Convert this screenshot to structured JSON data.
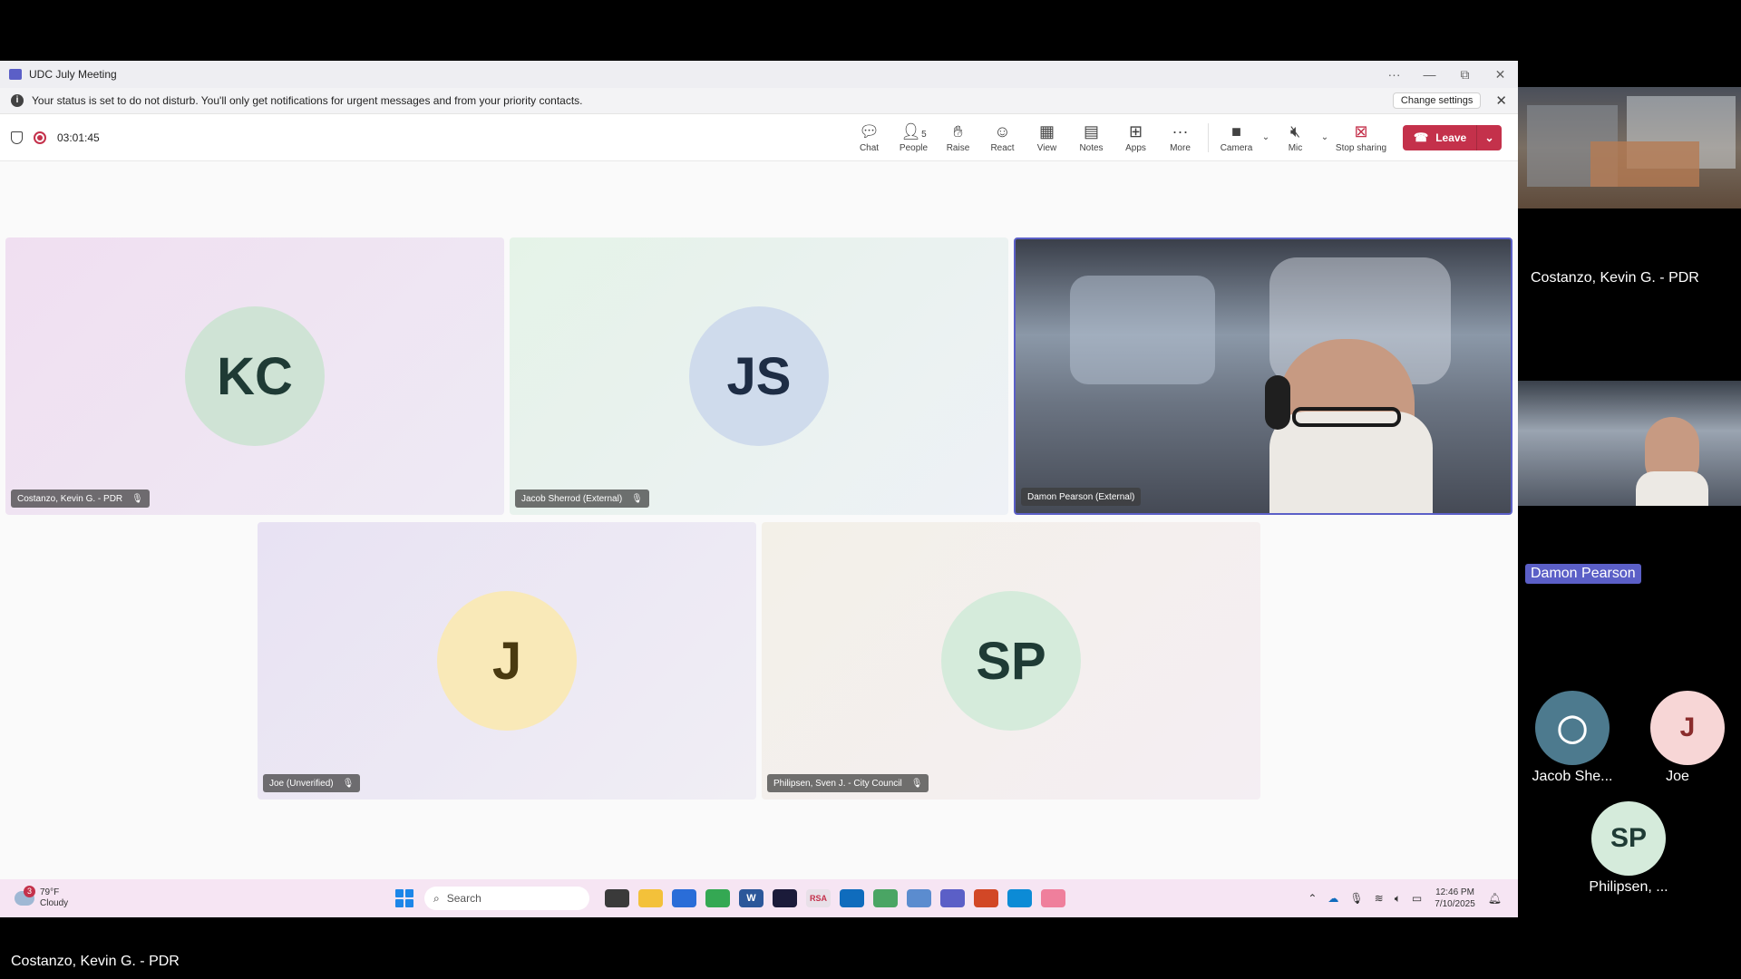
{
  "window": {
    "title": "UDC July Meeting",
    "controls": [
      "···",
      "—",
      "⧉",
      "✕"
    ]
  },
  "notice": {
    "text": "Your status is set to do not disturb. You'll only get notifications for urgent messages and from your priority contacts.",
    "button": "Change settings"
  },
  "toolbar": {
    "timer": "03:01:45",
    "buttons": [
      {
        "label": "Chat",
        "icon": "chat-icon"
      },
      {
        "label": "People",
        "icon": "people-icon",
        "count": "5"
      },
      {
        "label": "Raise",
        "icon": "hand-icon"
      },
      {
        "label": "React",
        "icon": "smile-icon"
      },
      {
        "label": "View",
        "icon": "grid-icon"
      },
      {
        "label": "Notes",
        "icon": "notes-icon"
      },
      {
        "label": "Apps",
        "icon": "plus-icon"
      },
      {
        "label": "More",
        "icon": "more-icon"
      }
    ],
    "camera": "Camera",
    "mic": "Mic",
    "stop_sharing": "Stop sharing",
    "leave": "Leave"
  },
  "participants": [
    {
      "initials": "KC",
      "name": "Costanzo, Kevin G. - PDR",
      "avatar_color": "#cfe3d5",
      "bg": "#f1e3f2"
    },
    {
      "initials": "JS",
      "name": "Jacob Sherrod (External)",
      "avatar_color": "#cfdbec",
      "bg": "#e8f3ea"
    },
    {
      "initials": "",
      "name": "Damon Pearson (External)",
      "video": true,
      "active_speaker": true
    },
    {
      "initials": "J",
      "name": "Joe (Unverified)",
      "avatar_color": "#f9e9b8",
      "bg": "#ece6f4"
    },
    {
      "initials": "SP",
      "name": "Philipsen, Sven J. - City Council",
      "avatar_color": "#d5ebdb",
      "bg": "#f3eef2"
    }
  ],
  "taskbar": {
    "weather_temp": "79°F",
    "weather_desc": "Cloudy",
    "weather_badge": "3",
    "search_placeholder": "Search",
    "time": "12:46 PM",
    "date": "7/10/2025"
  },
  "side_panel": {
    "name1": "Costanzo, Kevin G. - PDR",
    "name2": "Damon Pearson",
    "p1_name": "Jacob She...",
    "p2_name": "Joe",
    "p2_initial": "J",
    "p3_name": "Philipsen, ...",
    "p3_initials": "SP"
  },
  "bottom_caption": "Costanzo, Kevin G. - PDR",
  "colors": {
    "brand": "#5b5fc7",
    "leave": "#c4314b"
  }
}
